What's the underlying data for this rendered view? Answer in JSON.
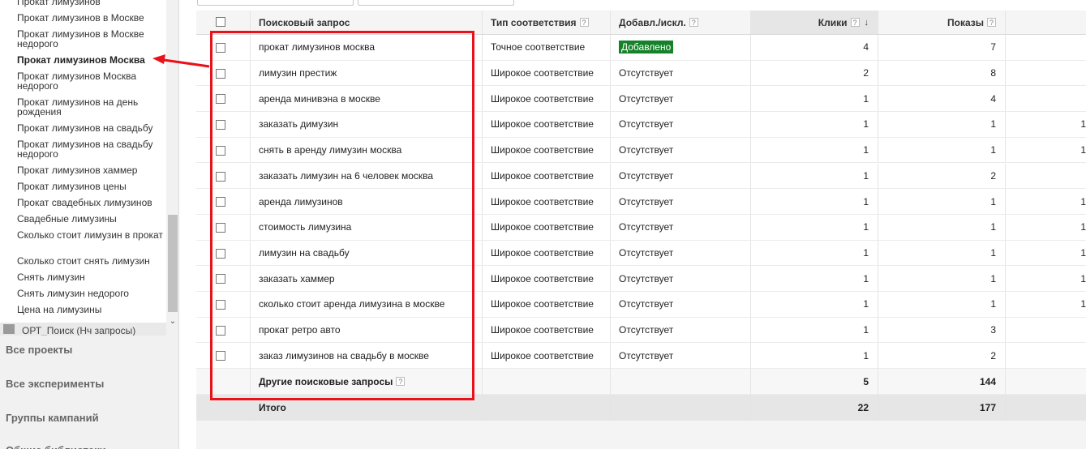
{
  "sidebar": {
    "items": [
      {
        "label": "Прокат лимузинов",
        "active": false
      },
      {
        "label": "Прокат лимузинов в Москве",
        "active": false
      },
      {
        "label": "Прокат лимузинов в Москве недорого",
        "active": false
      },
      {
        "label": "Прокат лимузинов Москва",
        "active": true
      },
      {
        "label": "Прокат лимузинов Москва недорого",
        "active": false
      },
      {
        "label": "Прокат лимузинов на день рождения",
        "active": false
      },
      {
        "label": "Прокат лимузинов на свадьбу",
        "active": false
      },
      {
        "label": "Прокат лимузинов на свадьбу недорого",
        "active": false
      },
      {
        "label": "Прокат лимузинов хаммер",
        "active": false
      },
      {
        "label": "Прокат лимузинов цены",
        "active": false
      },
      {
        "label": "Прокат свадебных лимузинов",
        "active": false
      },
      {
        "label": "Свадебные лимузины",
        "active": false
      },
      {
        "label": "Сколько стоит лимузин в прокат",
        "active": false
      },
      {
        "label": "Сколько стоит снять лимузин",
        "active": false
      },
      {
        "label": "Снять лимузин",
        "active": false
      },
      {
        "label": "Снять лимузин недорого",
        "active": false
      },
      {
        "label": "Цена на лимузины",
        "active": false
      }
    ],
    "search_row_label": "ОРТ_Поиск (Нч запросы)",
    "nav": [
      "Все проекты",
      "Все эксперименты",
      "Группы кампаний",
      "Общие библиотеки"
    ]
  },
  "table": {
    "headers": {
      "query": "Поисковый запрос",
      "match_type": "Тип соответствия",
      "added": "Добавл./искл.",
      "clicks": "Клики",
      "impressions": "Показы",
      "help": "?",
      "sort": "↓"
    },
    "rows": [
      {
        "query": "прокат лимузинов москва",
        "match_type": "Точное соответствие",
        "added": "Добавлено",
        "added_state": "added",
        "clicks": "4",
        "impressions": "7",
        "extra": ""
      },
      {
        "query": "лимузин престиж",
        "match_type": "Широкое соответствие",
        "added": "Отсутствует",
        "added_state": "none",
        "clicks": "2",
        "impressions": "8",
        "extra": ""
      },
      {
        "query": "аренда минивэна в москве",
        "match_type": "Широкое соответствие",
        "added": "Отсутствует",
        "added_state": "none",
        "clicks": "1",
        "impressions": "4",
        "extra": ""
      },
      {
        "query": "заказать димузин",
        "match_type": "Широкое соответствие",
        "added": "Отсутствует",
        "added_state": "none",
        "clicks": "1",
        "impressions": "1",
        "extra": "1"
      },
      {
        "query": "снять в аренду лимузин москва",
        "match_type": "Широкое соответствие",
        "added": "Отсутствует",
        "added_state": "none",
        "clicks": "1",
        "impressions": "1",
        "extra": "1"
      },
      {
        "query": "заказать лимузин на 6 человек москва",
        "match_type": "Широкое соответствие",
        "added": "Отсутствует",
        "added_state": "none",
        "clicks": "1",
        "impressions": "2",
        "extra": ""
      },
      {
        "query": "аренда лимузинов",
        "match_type": "Широкое соответствие",
        "added": "Отсутствует",
        "added_state": "none",
        "clicks": "1",
        "impressions": "1",
        "extra": "1"
      },
      {
        "query": "стоимость лимузина",
        "match_type": "Широкое соответствие",
        "added": "Отсутствует",
        "added_state": "none",
        "clicks": "1",
        "impressions": "1",
        "extra": "1"
      },
      {
        "query": "лимузин на свадьбу",
        "match_type": "Широкое соответствие",
        "added": "Отсутствует",
        "added_state": "none",
        "clicks": "1",
        "impressions": "1",
        "extra": "1"
      },
      {
        "query": "заказать хаммер",
        "match_type": "Широкое соответствие",
        "added": "Отсутствует",
        "added_state": "none",
        "clicks": "1",
        "impressions": "1",
        "extra": "1"
      },
      {
        "query": "сколько стоит аренда лимузина в москве",
        "match_type": "Широкое соответствие",
        "added": "Отсутствует",
        "added_state": "none",
        "clicks": "1",
        "impressions": "1",
        "extra": "1"
      },
      {
        "query": "прокат ретро авто",
        "match_type": "Широкое соответствие",
        "added": "Отсутствует",
        "added_state": "none",
        "clicks": "1",
        "impressions": "3",
        "extra": ""
      },
      {
        "query": "заказ лимузинов на свадьбу в москве",
        "match_type": "Широкое соответствие",
        "added": "Отсутствует",
        "added_state": "none",
        "clicks": "1",
        "impressions": "2",
        "extra": ""
      }
    ],
    "other_row": {
      "label": "Другие поисковые запросы",
      "clicks": "5",
      "impressions": "144"
    },
    "total_row": {
      "label": "Итого",
      "clicks": "22",
      "impressions": "177"
    }
  },
  "colors": {
    "added_badge": "#15822a",
    "annotation": "#e8121a"
  }
}
